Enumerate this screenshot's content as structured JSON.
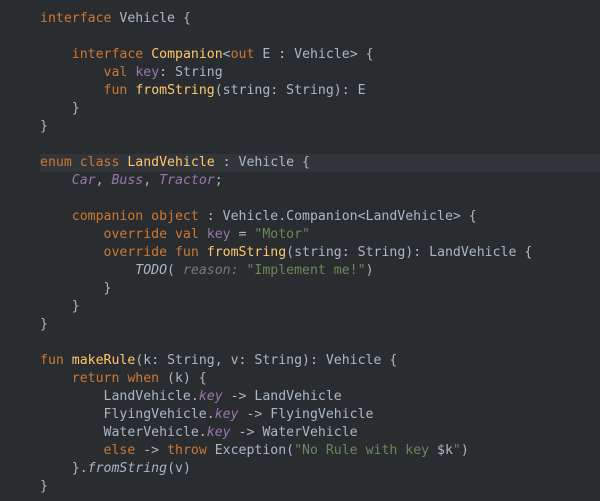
{
  "code": {
    "l1a": "interface",
    "l1b": "Vehicle {",
    "l2": "",
    "l3a": "interface",
    "l3b": "Companion",
    "l3c": "<",
    "l3d": "out",
    "l3e": " E : Vehicle> {",
    "l4a": "val",
    "l4b": "key",
    "l4c": ": String",
    "l5a": "fun",
    "l5b": "fromString",
    "l5c": "(string: String): E",
    "l6": "}",
    "l7": "}",
    "l8": "",
    "l9a": "enum class",
    "l9b": "LandVehicle",
    "l9c": " : Vehicle {",
    "l10a": "Car",
    "l10b": ", ",
    "l10c": "Buss",
    "l10d": ", ",
    "l10e": "Tractor",
    "l10f": ";",
    "l11": "",
    "l12a": "companion object",
    "l12b": " : Vehicle.Companion<LandVehicle> {",
    "l13a": "override val",
    "l13b": "key",
    "l13c": " = ",
    "l13d": "\"Motor\"",
    "l14a": "override fun",
    "l14b": "fromString",
    "l14c": "(string: String): LandVehicle {",
    "l15a": "TODO",
    "l15b": "(",
    "l15c": " reason: ",
    "l15d": "\"Implement me!\"",
    "l15e": ")",
    "l16": "}",
    "l17": "}",
    "l18": "}",
    "l19": "",
    "l20a": "fun",
    "l20b": "makeRule",
    "l20c": "(k: String, v: String): Vehicle {",
    "l21a": "return when",
    "l21b": " (k) {",
    "l22a": "LandVehicle.",
    "l22b": "key",
    "l22c": " -> LandVehicle",
    "l23a": "FlyingVehicle.",
    "l23b": "key",
    "l23c": " -> FlyingVehicle",
    "l24a": "WaterVehicle.",
    "l24b": "key",
    "l24c": " -> WaterVehicle",
    "l25a": "else",
    "l25b": " -> ",
    "l25c": "throw",
    "l25d": " Exception(",
    "l25e": "\"No Rule with key ",
    "l25f": "$k",
    "l25g": "\"",
    "l25h": ")",
    "l26a": "}.",
    "l26b": "fromString",
    "l26c": "(v)",
    "l27": "}"
  }
}
